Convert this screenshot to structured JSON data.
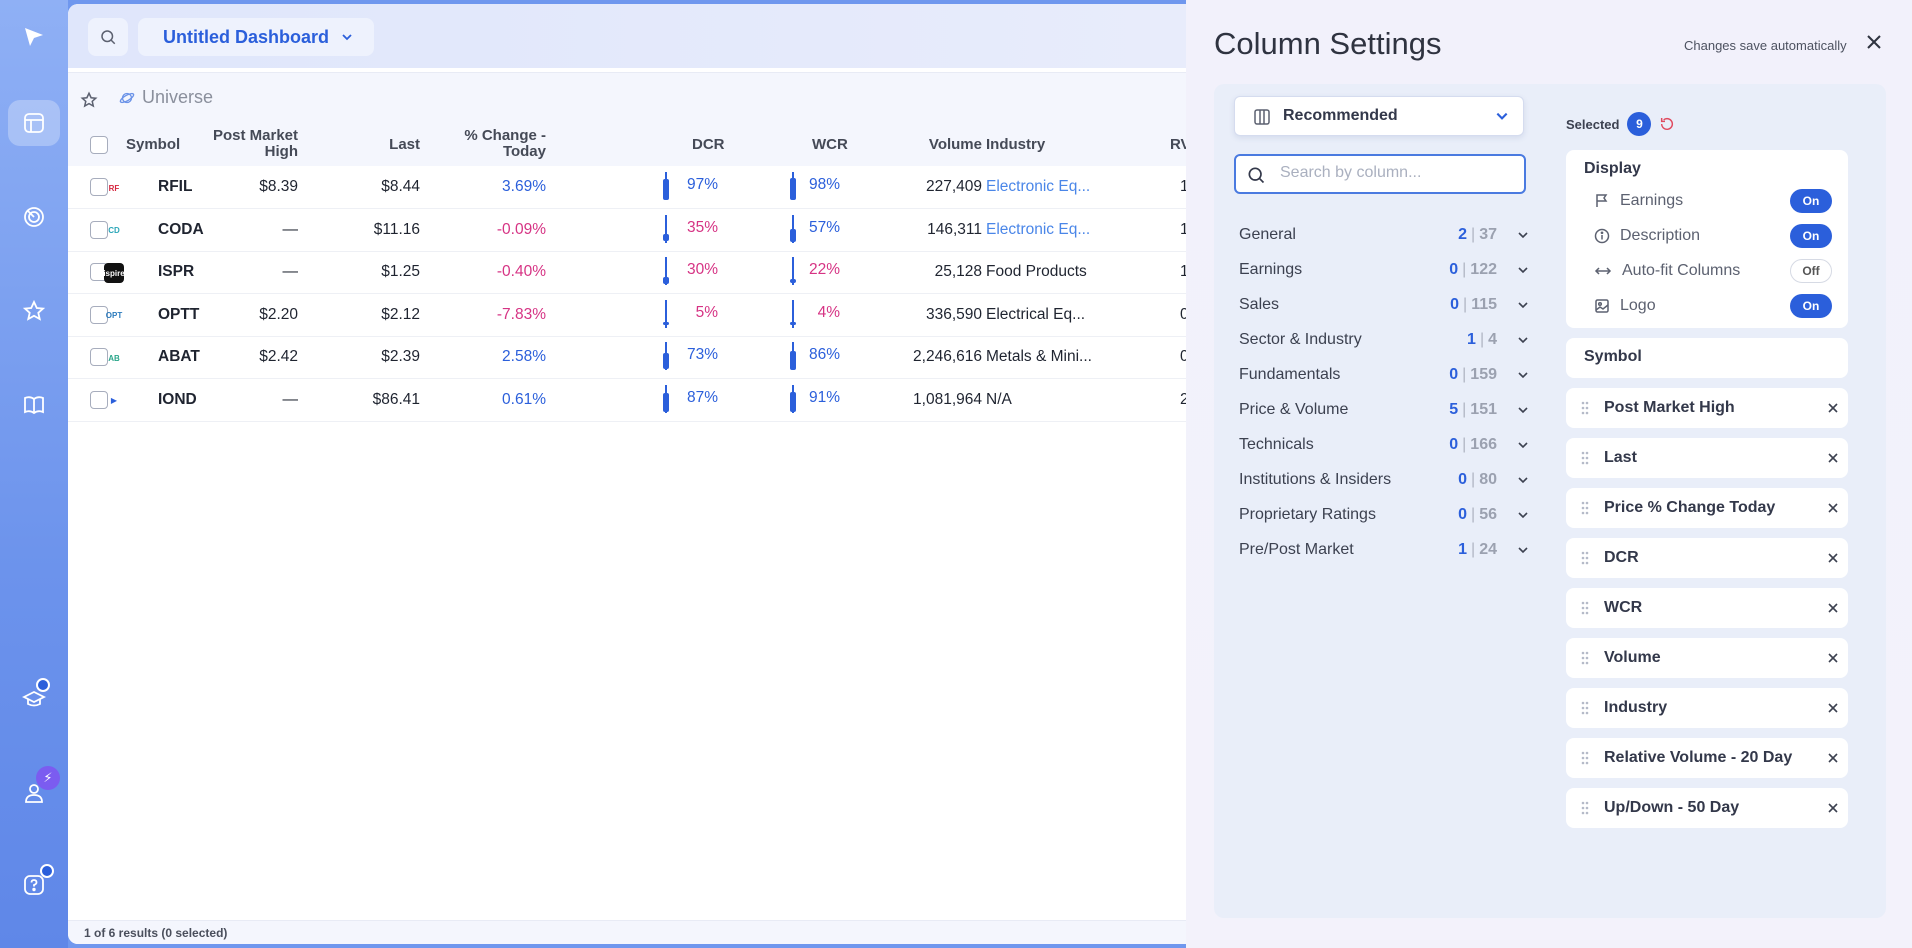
{
  "dashboard": {
    "title": "Untitled Dashboard"
  },
  "tab": {
    "label": "Universe"
  },
  "table": {
    "headers": {
      "symbol": "Symbol",
      "post_market_high": "Post Market High",
      "last": "Last",
      "pct_change": "% Change - Today",
      "dcr": "DCR",
      "wcr": "WCR",
      "volume": "Volume",
      "industry": "Industry",
      "rv": "RV"
    },
    "rows": [
      {
        "symbol": "RFIL",
        "logo": "RF",
        "pmh": "$8.39",
        "last": "$8.44",
        "chg": "3.69%",
        "chg_dir": "pos",
        "dcr": "97%",
        "dcr_dir": "pos",
        "wcr": "98%",
        "wcr_dir": "pos",
        "volume": "227,409",
        "industry": "Electronic Eq...",
        "industry_link": true,
        "rv": "1"
      },
      {
        "symbol": "CODA",
        "logo": "CD",
        "pmh": "—",
        "last": "$11.16",
        "chg": "-0.09%",
        "chg_dir": "neg",
        "dcr": "35%",
        "dcr_dir": "neg",
        "wcr": "57%",
        "wcr_dir": "pos",
        "volume": "146,311",
        "industry": "Electronic Eq...",
        "industry_link": true,
        "rv": "1"
      },
      {
        "symbol": "ISPR",
        "logo": "ispire",
        "pmh": "—",
        "last": "$1.25",
        "chg": "-0.40%",
        "chg_dir": "neg",
        "dcr": "30%",
        "dcr_dir": "neg",
        "wcr": "22%",
        "wcr_dir": "neg",
        "volume": "25,128",
        "industry": "Food Products",
        "industry_link": false,
        "rv": "1"
      },
      {
        "symbol": "OPTT",
        "logo": "OPT",
        "pmh": "$2.20",
        "last": "$2.12",
        "chg": "-7.83%",
        "chg_dir": "neg",
        "dcr": "5%",
        "dcr_dir": "neg",
        "wcr": "4%",
        "wcr_dir": "neg",
        "volume": "336,590",
        "industry": "Electrical Eq...",
        "industry_link": false,
        "rv": "0"
      },
      {
        "symbol": "ABAT",
        "logo": "AB",
        "pmh": "$2.42",
        "last": "$2.39",
        "chg": "2.58%",
        "chg_dir": "pos",
        "dcr": "73%",
        "dcr_dir": "pos",
        "wcr": "86%",
        "wcr_dir": "pos",
        "volume": "2,246,616",
        "industry": "Metals & Mini...",
        "industry_link": false,
        "rv": "0"
      },
      {
        "symbol": "IOND",
        "logo": "▶",
        "pmh": "—",
        "last": "$86.41",
        "chg": "0.61%",
        "chg_dir": "pos",
        "dcr": "87%",
        "dcr_dir": "pos",
        "wcr": "91%",
        "wcr_dir": "pos",
        "volume": "1,081,964",
        "industry": "N/A",
        "industry_link": false,
        "rv": "2"
      }
    ],
    "footer": "1 of 6 results (0 selected)"
  },
  "settings": {
    "title": "Column Settings",
    "autosave": "Changes save automatically",
    "preset": "Recommended",
    "search_placeholder": "Search by column...",
    "categories": [
      {
        "label": "General",
        "selected": "2",
        "total": "37"
      },
      {
        "label": "Earnings",
        "selected": "0",
        "total": "122"
      },
      {
        "label": "Sales",
        "selected": "0",
        "total": "115"
      },
      {
        "label": "Sector & Industry",
        "selected": "1",
        "total": "4"
      },
      {
        "label": "Fundamentals",
        "selected": "0",
        "total": "159"
      },
      {
        "label": "Price & Volume",
        "selected": "5",
        "total": "151"
      },
      {
        "label": "Technicals",
        "selected": "0",
        "total": "166"
      },
      {
        "label": "Institutions & Insiders",
        "selected": "0",
        "total": "80"
      },
      {
        "label": "Proprietary Ratings",
        "selected": "0",
        "total": "56"
      },
      {
        "label": "Pre/Post Market",
        "selected": "1",
        "total": "24"
      }
    ],
    "selected_label": "Selected",
    "selected_count": "9",
    "display": {
      "title": "Display",
      "options": [
        {
          "label": "Earnings",
          "state": "On"
        },
        {
          "label": "Description",
          "state": "On"
        },
        {
          "label": "Auto-fit Columns",
          "state": "Off"
        },
        {
          "label": "Logo",
          "state": "On"
        }
      ]
    },
    "fixed_column": "Symbol",
    "columns": [
      "Post Market High",
      "Last",
      "Price % Change Today",
      "DCR",
      "WCR",
      "Volume",
      "Industry",
      "Relative Volume - 20 Day",
      "Up/Down - 50 Day"
    ]
  }
}
